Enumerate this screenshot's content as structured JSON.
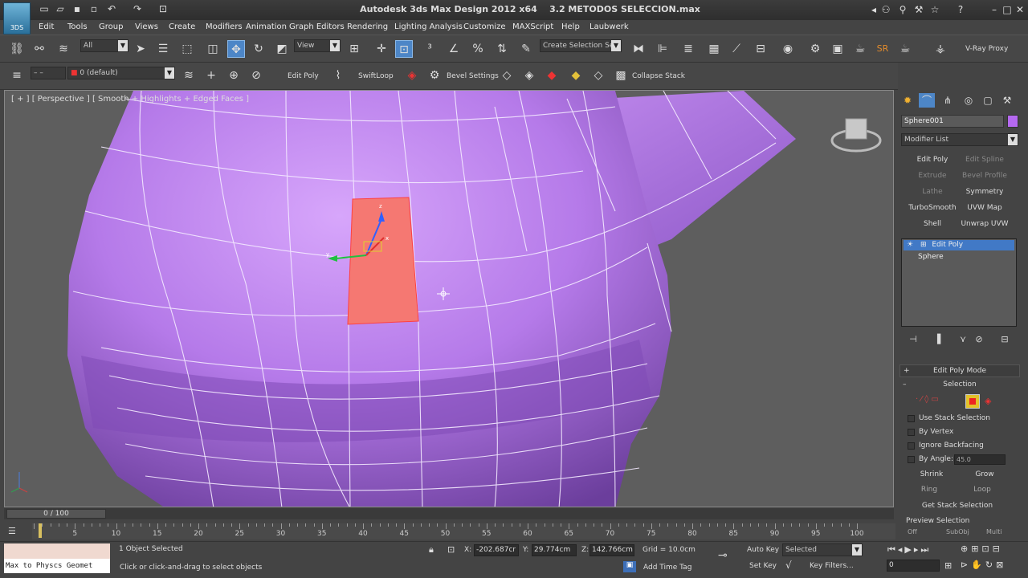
{
  "title": {
    "app": "Autodesk 3ds Max Design 2012 x64",
    "file": "3.2 METODOS SELECCION.max",
    "logo_text": "3DS"
  },
  "menus": [
    "Edit",
    "Tools",
    "Group",
    "Views",
    "Create",
    "Modifiers",
    "Animation",
    "Graph Editors",
    "Rendering",
    "Lighting Analysis",
    "Customize",
    "MAXScript",
    "Help",
    "Laubwerk"
  ],
  "toolbar1": {
    "filter": "All",
    "ref_coord": "View",
    "named_selection": "Create Selection Se",
    "vray_proxy": "V-Ray Proxy"
  },
  "toolbar2": {
    "layer": "0 (default)",
    "edit_poly": "Edit Poly",
    "swift_loop": "SwiftLoop",
    "bevel_settings": "Bevel Settings",
    "collapse_stack": "Collapse Stack"
  },
  "viewport": {
    "label": "[ + ] [ Perspective ] [ Smooth + Highlights + Edged Faces ]",
    "gizmo_axes": [
      "x",
      "y",
      "z"
    ]
  },
  "command_panel": {
    "object_name": "Sphere001",
    "object_color": "#b569f0",
    "modifier_list": "Modifier List",
    "modifier_buttons": [
      {
        "label": "Edit Poly",
        "enabled": true
      },
      {
        "label": "Edit Spline",
        "enabled": false
      },
      {
        "label": "Extrude",
        "enabled": false
      },
      {
        "label": "Bevel Profile",
        "enabled": false
      },
      {
        "label": "Lathe",
        "enabled": false
      },
      {
        "label": "Symmetry",
        "enabled": true
      },
      {
        "label": "TurboSmooth",
        "enabled": true
      },
      {
        "label": "UVW Map",
        "enabled": true
      },
      {
        "label": "Shell",
        "enabled": true
      },
      {
        "label": "Unwrap UVW",
        "enabled": true
      }
    ],
    "stack": [
      "Edit Poly",
      "Sphere"
    ],
    "rollout_mode": "Edit Poly Mode",
    "rollout_selection": "Selection",
    "checkboxes": [
      "Use Stack Selection",
      "By Vertex",
      "Ignore Backfacing",
      "By Angle:"
    ],
    "by_angle_value": "45.0",
    "shrink": "Shrink",
    "grow": "Grow",
    "ring": "Ring",
    "loop": "Loop",
    "get_stack_selection": "Get Stack Selection",
    "preview_selection": "Preview Selection",
    "preview_options": [
      "Off",
      "SubObj",
      "Multi"
    ]
  },
  "timeline": {
    "frame": "0 / 100",
    "ticks": [
      5,
      10,
      15,
      20,
      25,
      30,
      35,
      40,
      45,
      50,
      55,
      60,
      65,
      70,
      75,
      80,
      85,
      90,
      95,
      100
    ]
  },
  "status": {
    "maxscript": "Max to Physcs Geomet",
    "objects_selected": "1 Object Selected",
    "prompt": "Click or click-and-drag to select objects",
    "x_label": "X:",
    "x": "-202.687cr",
    "y_label": "Y:",
    "y": "29.774cm",
    "z_label": "Z:",
    "z": "142.766cm",
    "grid": "Grid = 10.0cm",
    "add_time_tag": "Add Time Tag",
    "auto_key": "Auto Key",
    "set_key": "Set Key",
    "key_mode": "Selected",
    "key_filters": "Key Filters...",
    "current_frame": "0"
  }
}
